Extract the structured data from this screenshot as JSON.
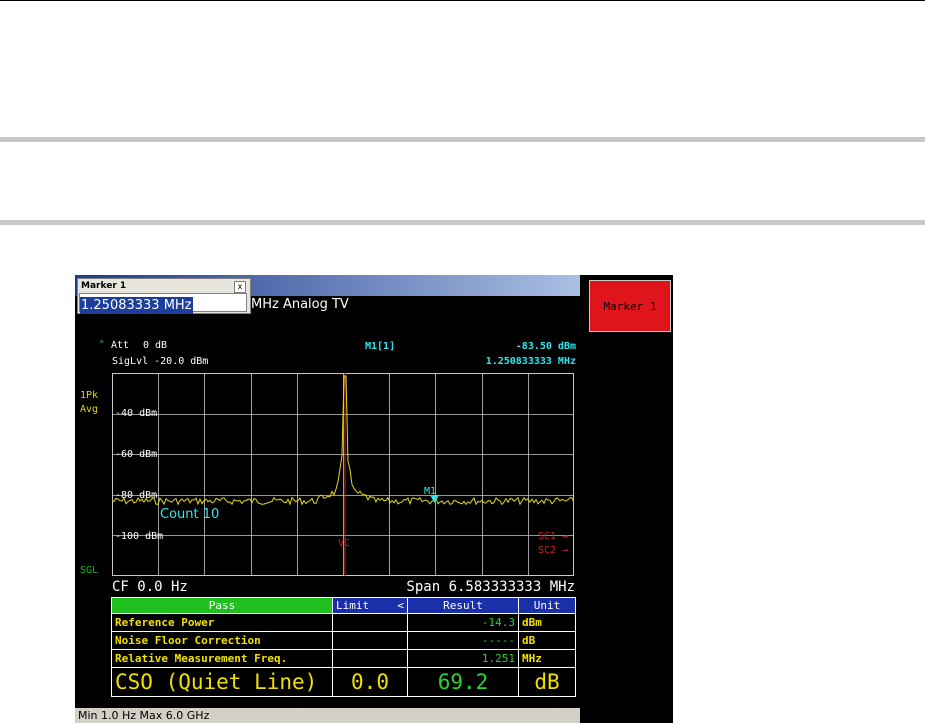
{
  "window": {
    "title_suffix": "MHz  Analog TV"
  },
  "marker_dialog": {
    "title": "Marker 1",
    "close_glyph": "x",
    "value": "1.25083333 MHz"
  },
  "softkey": {
    "label": "Marker 1"
  },
  "settings": {
    "att_label": "Att",
    "att_value": "0 dB",
    "siglvl": "SigLvl -20.0 dBm",
    "trace_mode_line1": "1Pk",
    "trace_mode_line2": "Avg",
    "sweep_mode": "SGL"
  },
  "marker_readout": {
    "name": "M1[1]",
    "level": "-83.50 dBm",
    "frequency": "1.250833333 MHz"
  },
  "plot": {
    "y_tick_labels": [
      "-40 dBm",
      "-60 dBm",
      "-80 dBm",
      "-100 dBm"
    ],
    "count_label": "Count 10",
    "marker_label": "M1",
    "vc_label": "VC",
    "sc1_label": "SC1 →",
    "sc2_label": "SC2 →"
  },
  "footer": {
    "cf": "CF 0.0 Hz",
    "span": "Span 6.583333333 MHz"
  },
  "results": {
    "headers": [
      "Pass",
      "Limit",
      "<",
      "Result",
      "Unit"
    ],
    "rows": [
      {
        "name": "Reference Power",
        "limit": "",
        "result": "-14.3",
        "unit": "dBm"
      },
      {
        "name": "Noise Floor Correction",
        "limit": "",
        "result": "-----",
        "unit": "dB"
      },
      {
        "name": "Relative Measurement Freq.",
        "limit": "",
        "result": "1.251",
        "unit": "MHz"
      }
    ],
    "main": {
      "name": "CSO (Quiet Line)",
      "limit": "0.0",
      "result": "69.2",
      "unit": "dB"
    }
  },
  "status_bar": {
    "text": "Min 1.0 Hz  Max 6.0 GHz"
  },
  "colors": {
    "trace": "#e6d81a",
    "grid": "#c8c8c8",
    "marker": "#2ee8ee",
    "vc_line": "#d02020",
    "pass": "#20c020"
  }
}
